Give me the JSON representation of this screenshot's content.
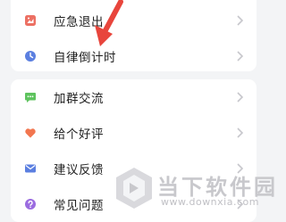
{
  "group1": {
    "items": [
      {
        "label": "应急退出",
        "icon": "emergency-exit-icon",
        "color": "#ec7063"
      },
      {
        "label": "自律倒计时",
        "icon": "clock-icon",
        "color": "#5b7fe0"
      }
    ]
  },
  "group2": {
    "items": [
      {
        "label": "加群交流",
        "icon": "chat-bubble-icon",
        "color": "#5ec35e"
      },
      {
        "label": "给个好评",
        "icon": "heart-icon",
        "color": "#f2764f"
      },
      {
        "label": "建议反馈",
        "icon": "mail-icon",
        "color": "#5b7fe0"
      },
      {
        "label": "常见问题",
        "icon": "question-icon",
        "color": "#9b6ce0"
      }
    ]
  },
  "watermark": {
    "brand": "当下软件园",
    "url": "www.downxia.com"
  },
  "colors": {
    "background": "#f3f4f6",
    "card": "#ffffff",
    "arrow": "#e8453c",
    "chevron": "#c7c7cc"
  }
}
